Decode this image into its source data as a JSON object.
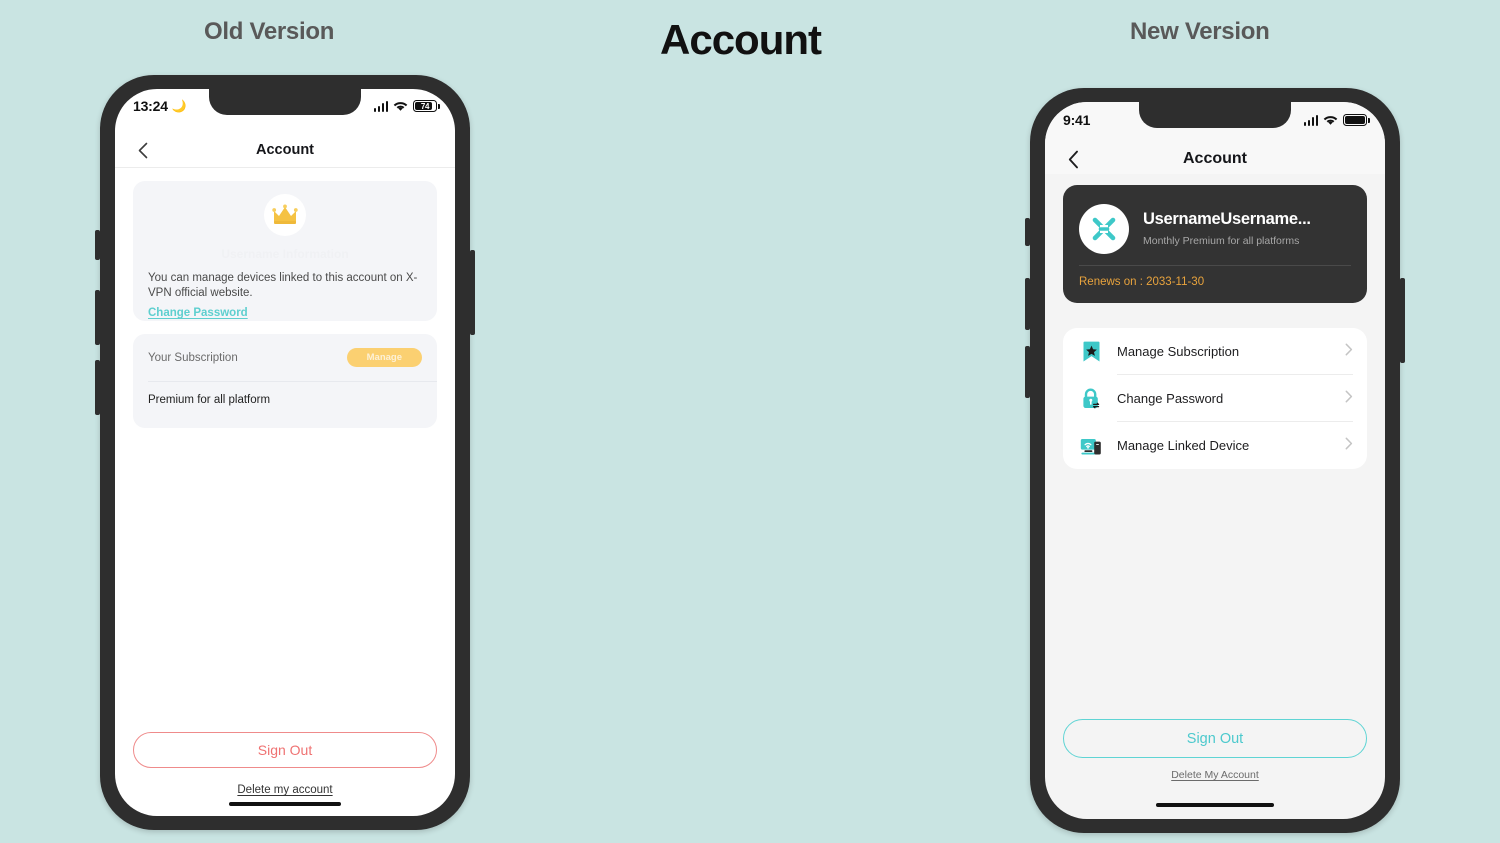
{
  "page": {
    "background_color": "#c9e4e2",
    "heading_old": "Old Version",
    "heading_main": "Account",
    "heading_new": "New Version"
  },
  "old_phone": {
    "status_bar": {
      "time": "13:24",
      "moon_icon": "crescent-moon-icon",
      "signal_icon": "cellular-signal-icon",
      "wifi_icon": "wifi-icon",
      "battery_icon": "battery-icon",
      "battery_level": "74"
    },
    "nav": {
      "back_icon": "chevron-left-icon",
      "title": "Account"
    },
    "info_card": {
      "crown_icon": "crown-icon",
      "ghost_text": "Username Information",
      "description": "You can manage devices linked to this account on X-VPN official website.",
      "change_password_link": "Change Password"
    },
    "subscription_card": {
      "label": "Your Subscription",
      "manage_button": "Manage",
      "plan": "Premium for all platform"
    },
    "footer": {
      "sign_out": "Sign Out",
      "delete_account": "Delete my account"
    },
    "colors": {
      "sign_out": "#ef7272",
      "manage_button": "#fbd071",
      "link": "#5ecfcf"
    }
  },
  "new_phone": {
    "status_bar": {
      "time": "9:41",
      "signal_icon": "cellular-signal-icon",
      "wifi_icon": "wifi-icon",
      "battery_icon": "battery-icon"
    },
    "nav": {
      "back_icon": "chevron-left-icon",
      "title": "Account"
    },
    "account_card": {
      "avatar_icon": "xvpn-logo-icon",
      "username": "UsernameUsername...",
      "plan": "Monthly Premium for all platforms",
      "renews": "Renews on : 2033-11-30"
    },
    "menu": [
      {
        "icon": "bookmark-star-icon",
        "label": "Manage Subscription",
        "chevron": "chevron-right-icon"
      },
      {
        "icon": "lock-icon",
        "label": "Change Password",
        "chevron": "chevron-right-icon"
      },
      {
        "icon": "monitor-device-icon",
        "label": "Manage Linked Device",
        "chevron": "chevron-right-icon"
      }
    ],
    "footer": {
      "sign_out": "Sign Out",
      "delete_account": "Delete My Account"
    },
    "colors": {
      "accent": "#4cc9cd",
      "card": "#333333",
      "renew_text": "#e8a33d"
    }
  }
}
